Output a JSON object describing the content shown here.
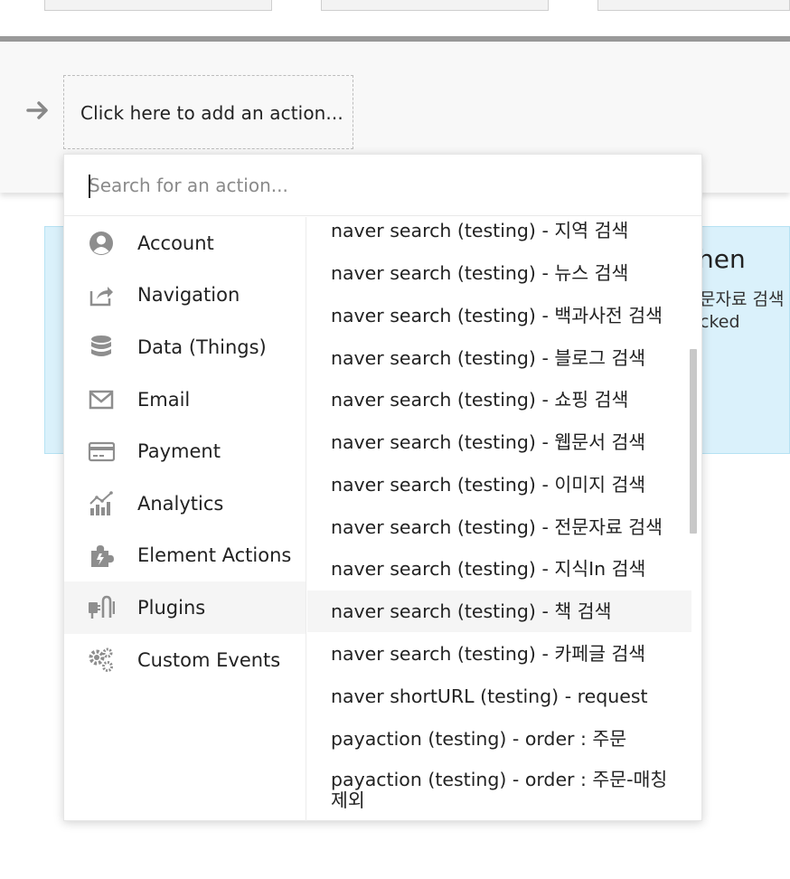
{
  "step": {
    "add_action_label": "Click here to add an action..."
  },
  "background_panel": {
    "title": "hen",
    "line1": "문자료 검색",
    "line2": "cked"
  },
  "dropdown": {
    "search_placeholder": "Search for an action...",
    "categories": [
      {
        "label": "Account",
        "icon": "user-icon"
      },
      {
        "label": "Navigation",
        "icon": "share-icon"
      },
      {
        "label": "Data (Things)",
        "icon": "database-icon"
      },
      {
        "label": "Email",
        "icon": "envelope-icon"
      },
      {
        "label": "Payment",
        "icon": "credit-card-icon"
      },
      {
        "label": "Analytics",
        "icon": "chart-icon"
      },
      {
        "label": "Element Actions",
        "icon": "puzzle-icon"
      },
      {
        "label": "Plugins",
        "icon": "plug-icon",
        "selected": true
      },
      {
        "label": "Custom Events",
        "icon": "gears-icon"
      }
    ],
    "actions": [
      "naver search (testing) - 지역 검색",
      "naver search (testing) - 뉴스 검색",
      "naver search (testing) - 백과사전 검색",
      "naver search (testing) - 블로그 검색",
      "naver search (testing) - 쇼핑 검색",
      "naver search (testing) - 웹문서 검색",
      "naver search (testing) - 이미지 검색",
      "naver search (testing) - 전문자료 검색",
      "naver search (testing) - 지식In 검색",
      "naver search (testing) - 책 검색",
      "naver search (testing) - 카페글 검색",
      "naver shortURL (testing) - request",
      "payaction (testing) - order : 주문",
      "payaction (testing) - order : 주문-매칭제외"
    ],
    "hovered_action_index": 9
  },
  "colors": {
    "panel_blue": "#daf1fb",
    "hover_gray": "#f5f5f5",
    "icon_gray": "#8e8e8e"
  }
}
